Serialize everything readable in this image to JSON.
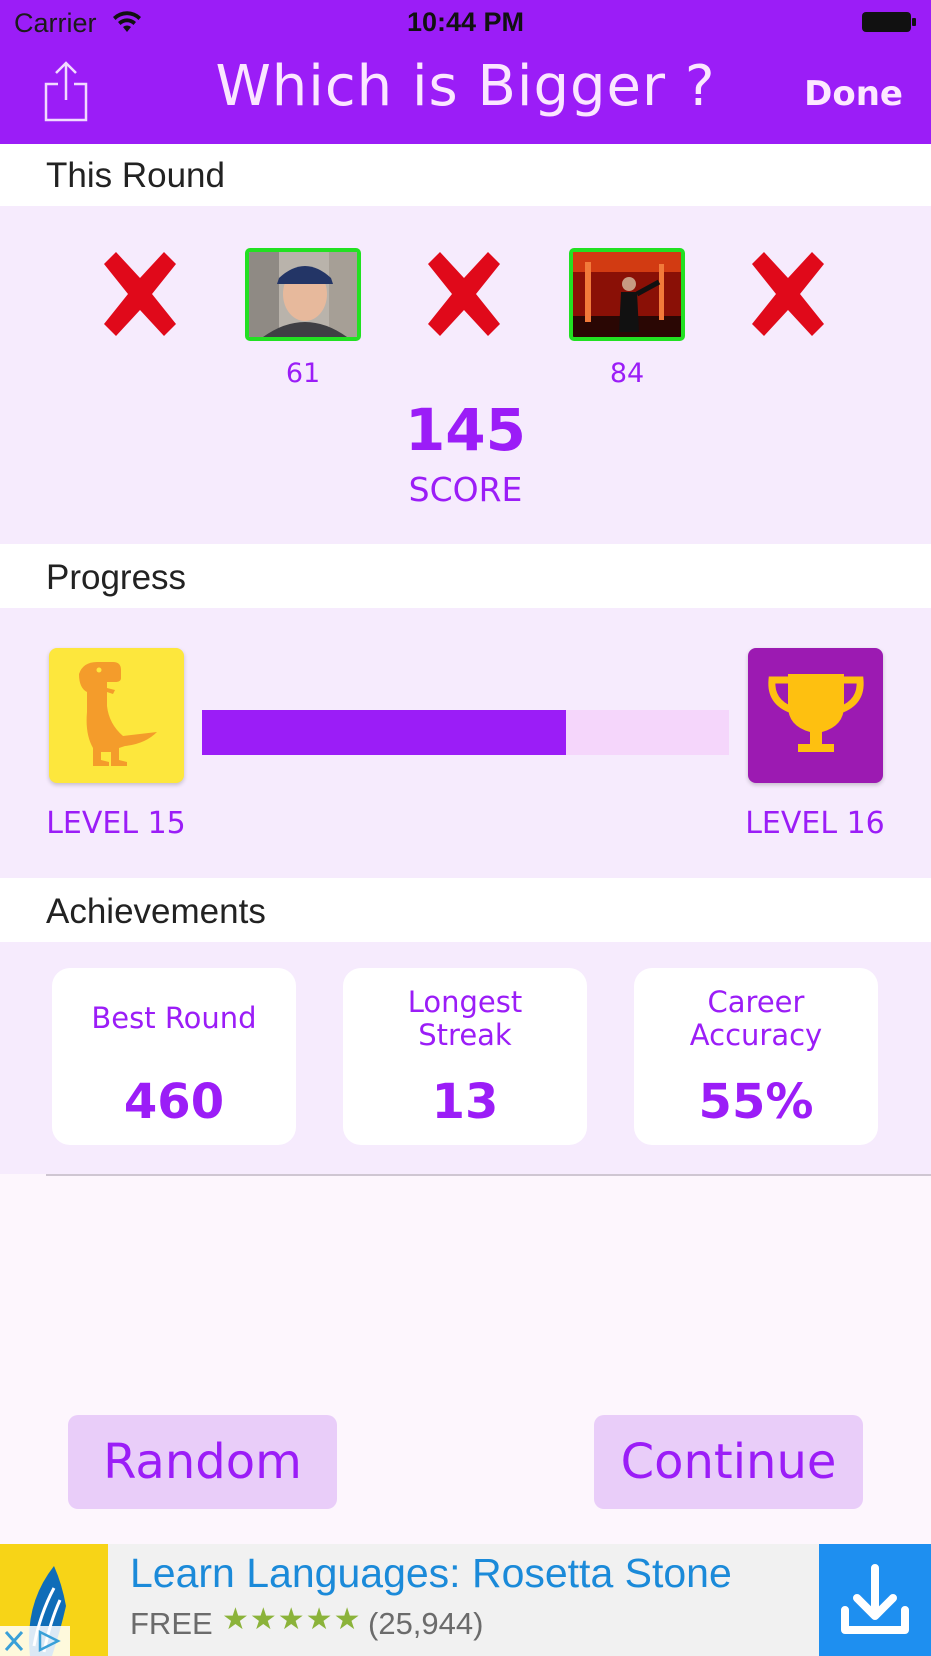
{
  "status_bar": {
    "carrier": "Carrier",
    "time": "10:44 PM"
  },
  "nav": {
    "title": "Which is Bigger ?",
    "done_label": "Done",
    "share_icon": "share-icon"
  },
  "round": {
    "header": "This Round",
    "items": [
      {
        "type": "miss"
      },
      {
        "type": "hit",
        "score": "61"
      },
      {
        "type": "miss"
      },
      {
        "type": "hit",
        "score": "84"
      },
      {
        "type": "miss"
      }
    ],
    "score_value": "145",
    "score_label": "SCORE"
  },
  "progress": {
    "header": "Progress",
    "current_level": "LEVEL 15",
    "next_level": "LEVEL 16",
    "fraction": 0.69,
    "current_icon": "dinosaur-icon",
    "next_icon": "trophy-icon"
  },
  "achievements": {
    "header": "Achievements",
    "cards": [
      {
        "title": "Best Round",
        "value": "460"
      },
      {
        "title": "Longest Streak",
        "value": "13"
      },
      {
        "title": "Career Accuracy",
        "value": "55%"
      }
    ]
  },
  "buttons": {
    "random": "Random",
    "continue": "Continue"
  },
  "ad": {
    "title": "Learn Languages: Rosetta Stone",
    "price": "FREE",
    "stars": "★★★★★",
    "reviews": "(25,944)"
  },
  "colors": {
    "accent": "#9b1df7",
    "panel": "#f6ebfd",
    "hit_border": "#22e022",
    "miss": "#e0091a"
  }
}
